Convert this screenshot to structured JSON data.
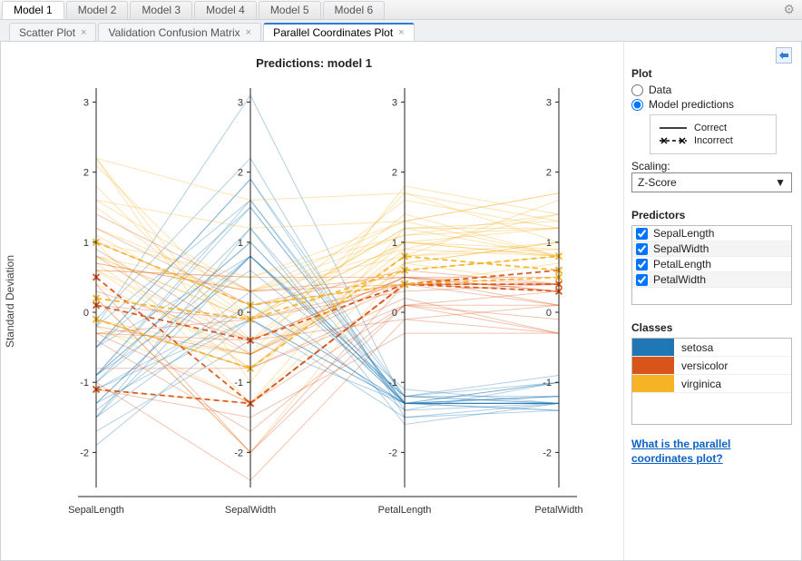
{
  "tabs": {
    "model_tabs": [
      "Model 1",
      "Model 2",
      "Model 3",
      "Model 4",
      "Model 5",
      "Model 6"
    ],
    "active_model": "Model 1",
    "sub_tabs": [
      {
        "label": "Scatter Plot",
        "closeable": true
      },
      {
        "label": "Validation Confusion Matrix",
        "closeable": true
      },
      {
        "label": "Parallel Coordinates Plot",
        "closeable": true
      }
    ],
    "active_sub": "Parallel Coordinates Plot"
  },
  "chart_data": {
    "type": "parallel-coordinates",
    "title": "Predictions: model 1",
    "ylabel": "Standard Deviation",
    "axes": [
      "SepalLength",
      "SepalWidth",
      "PetalLength",
      "PetalWidth"
    ],
    "ylim": [
      -2.5,
      3.2
    ],
    "ticks": [
      3,
      2,
      1,
      0,
      -1,
      -2
    ],
    "classes": [
      {
        "name": "setosa",
        "color": "#1f77b4"
      },
      {
        "name": "versicolor",
        "color": "#d9541a"
      },
      {
        "name": "virginica",
        "color": "#f5b325"
      }
    ],
    "legend_lines": [
      {
        "label": "Correct",
        "style": "solid"
      },
      {
        "label": "Incorrect",
        "style": "dashed-x"
      }
    ],
    "series": {
      "setosa_correct": [
        [
          -0.9,
          1.0,
          -1.3,
          -1.3
        ],
        [
          -1.1,
          -0.1,
          -1.3,
          -1.3
        ],
        [
          -1.4,
          0.3,
          -1.4,
          -1.3
        ],
        [
          -1.5,
          0.1,
          -1.3,
          -1.3
        ],
        [
          -1.0,
          1.2,
          -1.3,
          -1.3
        ],
        [
          -0.5,
          1.9,
          -1.2,
          -1.0
        ],
        [
          -1.5,
          0.8,
          -1.3,
          -1.2
        ],
        [
          -1.0,
          0.8,
          -1.3,
          -1.3
        ],
        [
          -1.7,
          -0.4,
          -1.3,
          -1.3
        ],
        [
          -1.1,
          0.1,
          -1.3,
          -1.4
        ],
        [
          -0.5,
          1.5,
          -1.3,
          -1.3
        ],
        [
          -1.3,
          0.8,
          -1.2,
          -1.3
        ],
        [
          -1.3,
          -0.1,
          -1.3,
          -1.4
        ],
        [
          -1.9,
          -0.1,
          -1.5,
          -1.4
        ],
        [
          -0.1,
          2.2,
          -1.5,
          -1.3
        ],
        [
          -0.2,
          3.1,
          -1.3,
          -1.0
        ],
        [
          -0.5,
          1.9,
          -1.4,
          -1.0
        ],
        [
          -0.9,
          1.0,
          -1.3,
          -1.2
        ],
        [
          -0.2,
          1.6,
          -1.2,
          -1.2
        ],
        [
          -0.9,
          1.6,
          -1.3,
          -1.2
        ],
        [
          -0.5,
          0.8,
          -1.2,
          -1.3
        ],
        [
          -0.9,
          1.5,
          -1.3,
          -1.0
        ],
        [
          -1.5,
          1.2,
          -1.6,
          -1.3
        ],
        [
          -0.9,
          0.6,
          -1.2,
          -0.9
        ],
        [
          -1.3,
          0.8,
          -1.1,
          -1.3
        ]
      ],
      "versicolor_correct": [
        [
          1.4,
          0.3,
          0.5,
          0.3
        ],
        [
          0.7,
          0.3,
          0.4,
          0.4
        ],
        [
          1.2,
          0.1,
          0.6,
          0.4
        ],
        [
          -0.4,
          -1.7,
          0.1,
          0.1
        ],
        [
          0.8,
          -0.6,
          0.5,
          0.4
        ],
        [
          -0.2,
          -0.6,
          0.4,
          0.1
        ],
        [
          0.6,
          0.5,
          0.5,
          0.5
        ],
        [
          -1.1,
          -1.5,
          -0.3,
          -0.3
        ],
        [
          0.9,
          -0.4,
          0.5,
          0.1
        ],
        [
          -0.8,
          -0.8,
          0.1,
          0.3
        ],
        [
          -1.0,
          -2.4,
          -0.1,
          -0.3
        ],
        [
          0.1,
          -0.1,
          0.3,
          0.4
        ],
        [
          0.2,
          -2.0,
          0.1,
          -0.3
        ],
        [
          0.3,
          -0.4,
          0.5,
          0.3
        ],
        [
          -0.3,
          -0.4,
          -0.1,
          0.1
        ],
        [
          1.0,
          0.1,
          0.4,
          0.3
        ],
        [
          -0.3,
          -0.1,
          0.4,
          0.4
        ],
        [
          -0.1,
          -0.8,
          0.2,
          -0.3
        ],
        [
          0.4,
          -2.0,
          0.4,
          0.4
        ],
        [
          -0.3,
          -1.3,
          0.1,
          -0.1
        ]
      ],
      "versicolor_incorrect": [
        [
          0.1,
          -0.4,
          0.4,
          0.4
        ],
        [
          0.5,
          -1.3,
          0.4,
          0.3
        ],
        [
          -1.1,
          -1.3,
          0.4,
          0.6
        ]
      ],
      "virginica_correct": [
        [
          0.6,
          0.5,
          1.3,
          1.7
        ],
        [
          -0.1,
          -0.8,
          0.8,
          0.9
        ],
        [
          1.5,
          -0.1,
          1.2,
          1.2
        ],
        [
          0.6,
          -0.4,
          1.0,
          0.8
        ],
        [
          0.8,
          -0.1,
          1.2,
          1.3
        ],
        [
          2.1,
          -0.1,
          1.6,
          1.2
        ],
        [
          -1.1,
          -1.3,
          0.4,
          0.7
        ],
        [
          1.8,
          -0.4,
          1.4,
          0.8
        ],
        [
          1.0,
          -1.3,
          1.2,
          0.8
        ],
        [
          1.6,
          1.2,
          1.3,
          1.7
        ],
        [
          0.8,
          0.3,
          0.8,
          1.0
        ],
        [
          0.7,
          -0.8,
          1.0,
          0.9
        ],
        [
          1.1,
          -0.1,
          1.0,
          1.2
        ],
        [
          -0.2,
          -1.3,
          0.7,
          1.0
        ],
        [
          -0.1,
          -0.6,
          0.8,
          1.6
        ],
        [
          0.7,
          0.3,
          0.9,
          1.4
        ],
        [
          0.8,
          -0.1,
          1.0,
          0.8
        ],
        [
          2.2,
          1.6,
          1.7,
          1.3
        ],
        [
          2.2,
          -1.0,
          1.8,
          1.4
        ],
        [
          0.2,
          -2.0,
          0.7,
          0.4
        ],
        [
          1.2,
          0.3,
          1.1,
          1.4
        ],
        [
          -0.3,
          -0.6,
          0.7,
          1.0
        ],
        [
          2.2,
          -0.6,
          1.7,
          1.0
        ],
        [
          0.6,
          -0.8,
          0.9,
          0.8
        ],
        [
          1.0,
          0.5,
          1.1,
          1.2
        ],
        [
          1.6,
          0.3,
          1.3,
          0.8
        ],
        [
          0.4,
          -0.6,
          0.6,
          0.8
        ]
      ],
      "virginica_incorrect": [
        [
          0.2,
          -0.1,
          0.6,
          0.8
        ],
        [
          -0.1,
          -0.8,
          0.8,
          0.6
        ],
        [
          1.0,
          0.1,
          0.4,
          0.5
        ]
      ]
    }
  },
  "side": {
    "plot_heading": "Plot",
    "radio_data": "Data",
    "radio_pred": "Model predictions",
    "radio_selected": "Model predictions",
    "scaling_label": "Scaling:",
    "scaling_value": "Z-Score",
    "predictors_heading": "Predictors",
    "predictors": [
      {
        "label": "SepalLength",
        "checked": true
      },
      {
        "label": "SepalWidth",
        "checked": true
      },
      {
        "label": "PetalLength",
        "checked": true
      },
      {
        "label": "PetalWidth",
        "checked": true
      }
    ],
    "classes_heading": "Classes",
    "help_link": "What is the parallel coordinates plot?"
  }
}
